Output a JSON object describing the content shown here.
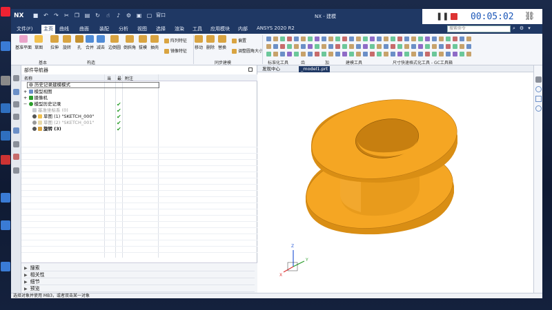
{
  "app": {
    "logo": "NX",
    "window_title": "NX - 建模",
    "window_menu": "窗口"
  },
  "recorder": {
    "pause_icon": "pause-icon",
    "stop_icon": "stop-icon",
    "time": "00:05:02",
    "link_icon": "link-icon"
  },
  "menu": {
    "items": [
      "文件(F)",
      "主页",
      "曲线",
      "曲面",
      "装配",
      "分析",
      "视图",
      "选择",
      "渲染",
      "工具",
      "应用模块",
      "内部",
      "ANSYS 2020 R2"
    ],
    "active": "主页",
    "search_placeholder": "搜索命令"
  },
  "ribbon": {
    "buttons": [
      "基准平面",
      "草图",
      "拉伸",
      "旋转",
      "孔",
      "合并",
      "减去",
      "边倒圆",
      "倒斜角",
      "拔模",
      "抽壳"
    ],
    "small": [
      "阵列特征",
      "镜像特征",
      "偏置",
      "调整圆角大小"
    ],
    "buttons2": [
      "移动",
      "删除",
      "替换"
    ],
    "groups": [
      "构造",
      "基本",
      "同步建模",
      "标准化工具",
      "齿",
      "加",
      "建模工具",
      "尺寸快速格式化工具 - GC工具箱"
    ]
  },
  "navigator": {
    "title": "部件导航器",
    "headers": [
      "名称",
      "当",
      "最",
      "附注"
    ],
    "rows": [
      {
        "label": "历史记录建模模式",
        "check": ""
      },
      {
        "label": "模型视图",
        "check": ""
      },
      {
        "label": "摄像机",
        "check": ""
      },
      {
        "label": "模型历史记录",
        "check": "✔"
      },
      {
        "label": "基准坐标系 (0)",
        "check": "✔"
      },
      {
        "label": "草图 (1) \"SKETCH_000\"",
        "check": "✔"
      },
      {
        "label": "草图 (2) \"SKETCH_001\"",
        "check": "✔"
      },
      {
        "label": "旋转 (3)",
        "check": "✔"
      }
    ],
    "bottom": [
      "搜索",
      "相关性",
      "细节",
      "预览"
    ]
  },
  "graphics": {
    "tabs": [
      "发现中心",
      "_model1.prt"
    ],
    "active_tab": "_model1.prt",
    "part_color": "#F5A623",
    "axis_labels": [
      "Z",
      "Y",
      "X"
    ]
  },
  "status": {
    "text": "选择对象并使用 MB3，或者双击某一对象"
  }
}
